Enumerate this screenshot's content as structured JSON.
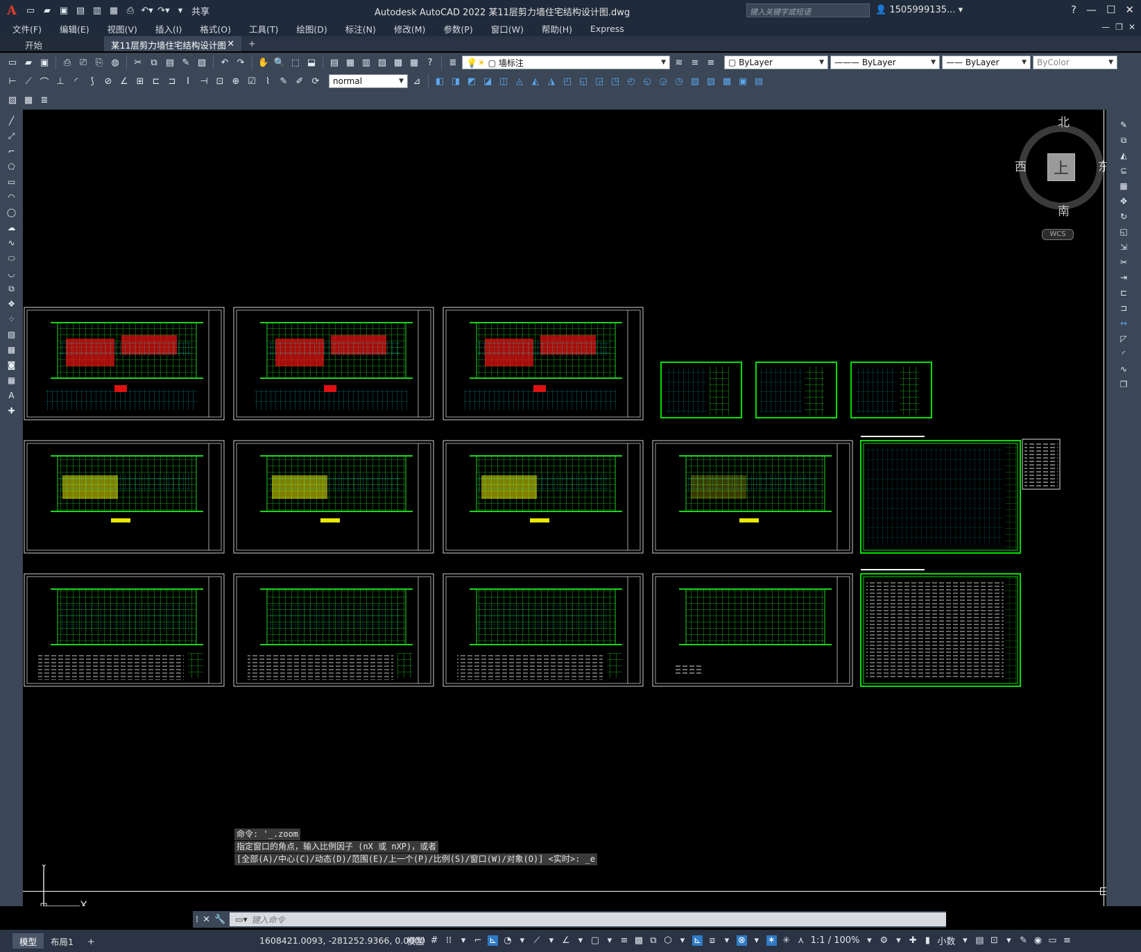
{
  "app": {
    "logo": "A",
    "title": "Autodesk AutoCAD 2022    某11层剪力墙住宅结构设计图.dwg",
    "share": "共享",
    "search_placeholder": "键入关键字或短语",
    "user": "1505999135...",
    "window_buttons": [
      "—",
      "☐",
      "✕"
    ]
  },
  "menu": [
    "文件(F)",
    "编辑(E)",
    "视图(V)",
    "插入(I)",
    "格式(O)",
    "工具(T)",
    "绘图(D)",
    "标注(N)",
    "修改(M)",
    "参数(P)",
    "窗口(W)",
    "帮助(H)",
    "Express"
  ],
  "tabs": {
    "start": "开始",
    "active": "某11层剪力墙住宅结构设计图*",
    "close": "✕",
    "add": "+"
  },
  "toolbar": {
    "layer": "墙标注",
    "color": "ByLayer",
    "linetype": "ByLayer",
    "lineweight": "ByLayer",
    "plotstyle": "ByColor",
    "dimstyle": "normal"
  },
  "viewcube": {
    "north": "北",
    "south": "南",
    "east": "东",
    "west": "西",
    "face": "上",
    "wcs": "WCS"
  },
  "ucs": {
    "x": "X",
    "y": "Y"
  },
  "command": {
    "history": [
      "命令: '_.zoom",
      "指定窗口的角点，输入比例因子 (nX 或 nXP)，或者",
      "[全部(A)/中心(C)/动态(D)/范围(E)/上一个(P)/比例(S)/窗口(W)/对象(O)] <实时>: _e"
    ],
    "placeholder": "键入命令"
  },
  "status": {
    "tabs": [
      "模型",
      "布局1",
      "+"
    ],
    "coords": "1608421.0093, -281252.9366, 0.0000",
    "model": "模型",
    "scale": "1:1 / 100%",
    "units": "小数"
  }
}
